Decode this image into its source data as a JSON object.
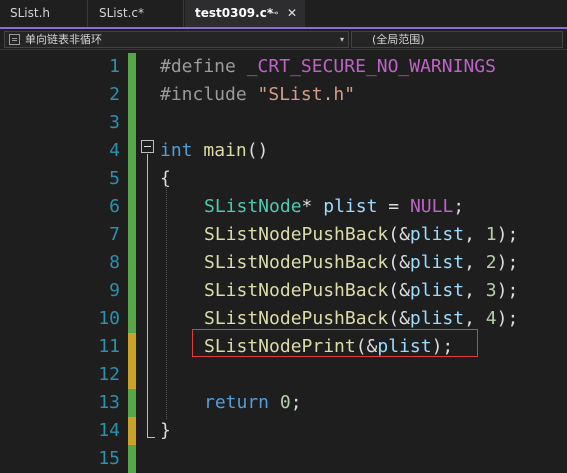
{
  "tabs": [
    {
      "label": "SList.h"
    },
    {
      "label": "SList.c*"
    },
    {
      "label": "test0309.c*",
      "pin": "⊸",
      "close": "✕"
    }
  ],
  "nav": {
    "scope_left": "单向链表非循环",
    "scope_right": "(全局范围)",
    "arrow": "▾"
  },
  "editor": {
    "lines": [
      {
        "no": "1"
      },
      {
        "no": "2"
      },
      {
        "no": "3"
      },
      {
        "no": "4"
      },
      {
        "no": "5"
      },
      {
        "no": "6"
      },
      {
        "no": "7"
      },
      {
        "no": "8"
      },
      {
        "no": "9"
      },
      {
        "no": "10"
      },
      {
        "no": "11"
      },
      {
        "no": "12"
      },
      {
        "no": "13"
      },
      {
        "no": "14"
      },
      {
        "no": "15"
      }
    ],
    "code": {
      "l1_directive": "#define",
      "l1_macro": "_CRT_SECURE_NO_WARNINGS",
      "l2_directive": "#include",
      "l2_string": "\"SList.h\"",
      "l4_type": "int",
      "l4_func": "main",
      "l4_parens": "()",
      "l5": "{",
      "l6_type": "SListNode",
      "l6_star": "*",
      "l6_var": "plist",
      "l6_eq": " = ",
      "l6_null": "NULL",
      "l6_end": ";",
      "push_func": "SListNodePushBack",
      "push_open": "(&",
      "push_var": "plist",
      "push_sep": ", ",
      "push_close": ");",
      "push_values": [
        "1",
        "2",
        "3",
        "4"
      ],
      "l11_func": "SListNodePrint",
      "l11_open": "(&",
      "l11_var": "plist",
      "l11_close": ");",
      "l13_return": "return",
      "l13_value": "0",
      "l13_end": ";",
      "l14": "}"
    }
  },
  "colors": {
    "change_saved": "#57a64a",
    "change_unsaved": "#c9a227",
    "highlight_box": "#e03c3c",
    "tab_accent": "#8c6bd6"
  }
}
